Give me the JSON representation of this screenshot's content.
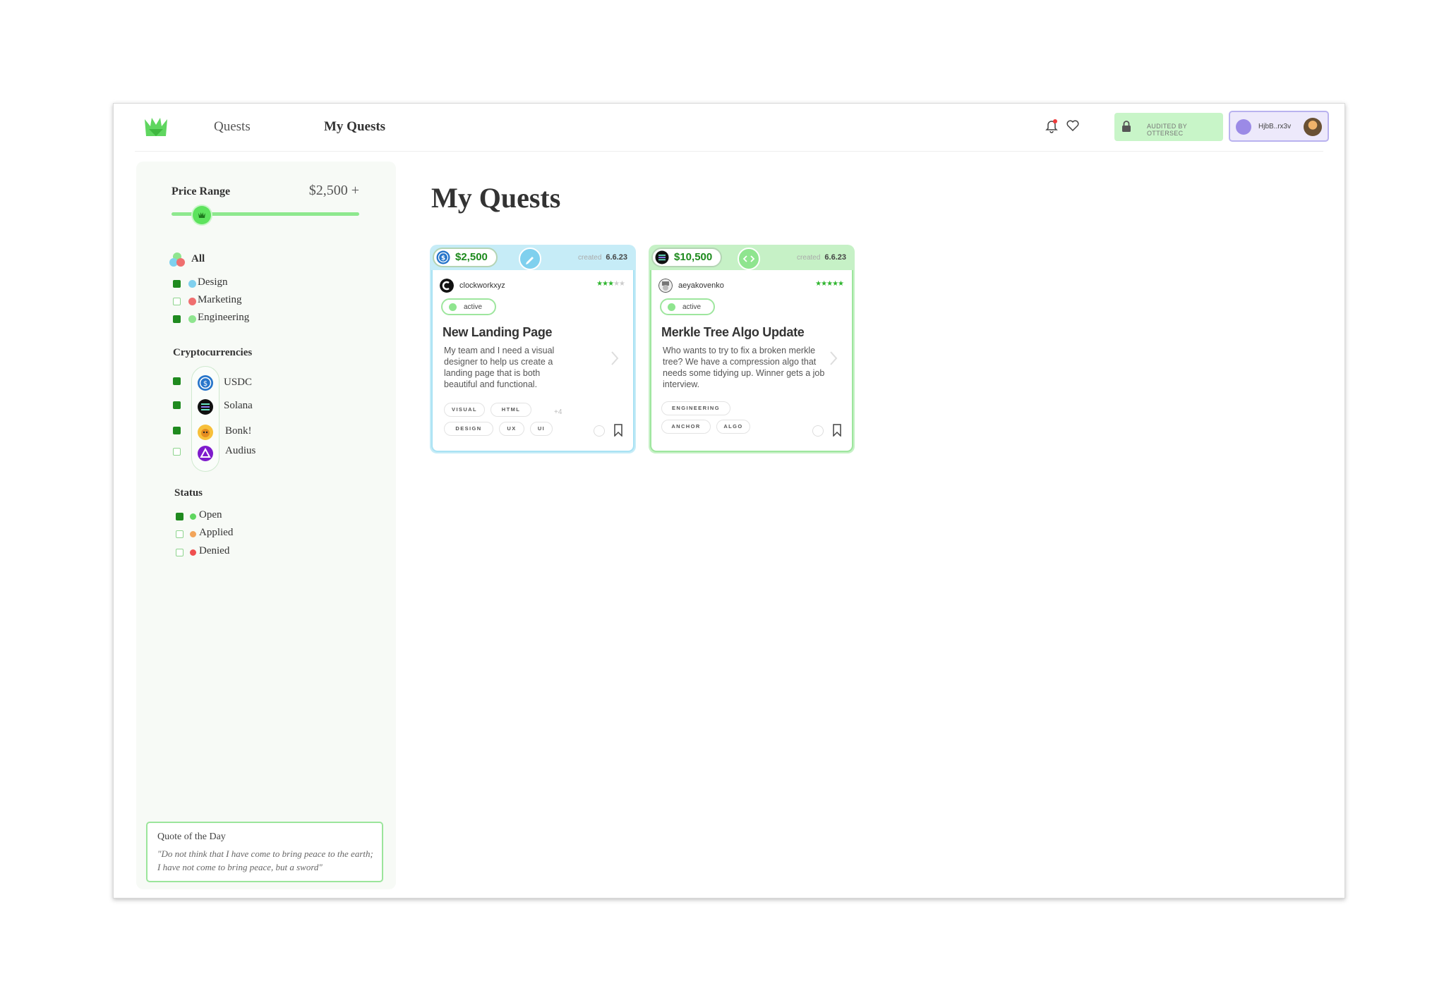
{
  "nav": {
    "quests_label": "Quests",
    "my_quests_label": "My Quests",
    "audit_label": "AUDITED BY OTTERSEC",
    "wallet_address": "HjbB..rx3v"
  },
  "sidebar": {
    "price_label": "Price Range",
    "price_value": "$2,500 +",
    "slider_fraction": 0.16,
    "categories": [
      {
        "label": "All",
        "checked": true
      },
      {
        "label": "Design",
        "checked": true,
        "color": "#7fd0ee"
      },
      {
        "label": "Marketing",
        "checked": false,
        "color": "#ef6f6f"
      },
      {
        "label": "Engineering",
        "checked": true,
        "color": "#8fe58f"
      }
    ],
    "crypto_title": "Cryptocurrencies",
    "cryptos": [
      {
        "label": "USDC",
        "checked": true
      },
      {
        "label": "Solana",
        "checked": true
      },
      {
        "label": "Bonk!",
        "checked": true
      },
      {
        "label": "Audius",
        "checked": false
      }
    ],
    "status_title": "Status",
    "statuses": [
      {
        "label": "Open",
        "checked": true,
        "color": "#5fd65f"
      },
      {
        "label": "Applied",
        "checked": false,
        "color": "#f2a55a"
      },
      {
        "label": "Denied",
        "checked": false,
        "color": "#ef4f4f"
      }
    ],
    "quote": {
      "title": "Quote of the Day",
      "text": "\"Do not think that I have come to bring peace to the earth; I have not come to bring peace, but a sword\""
    }
  },
  "main": {
    "title": "My Quests",
    "cards": [
      {
        "price": "$2,500",
        "created_label": "created",
        "created_date": "6.6.23",
        "author": "clockworkxyz",
        "rating": 3,
        "status": "active",
        "title": "New Landing Page",
        "description": "My team and I need a visual designer to help us create a landing page that is both beautiful and functional.",
        "tags": [
          "VISUAL",
          "HTML",
          "DESIGN",
          "UX",
          "UI"
        ],
        "more": "+4"
      },
      {
        "price": "$10,500",
        "created_label": "created",
        "created_date": "6.6.23",
        "author": "aeyakovenko",
        "rating": 5,
        "status": "active",
        "title": "Merkle Tree Algo Update",
        "description": "Who wants to try to fix a broken merkle tree? We have a compression algo that needs some tidying up. Winner gets a job interview.",
        "tags": [
          "ENGINEERING",
          "ANCHOR",
          "ALGO"
        ]
      }
    ]
  }
}
